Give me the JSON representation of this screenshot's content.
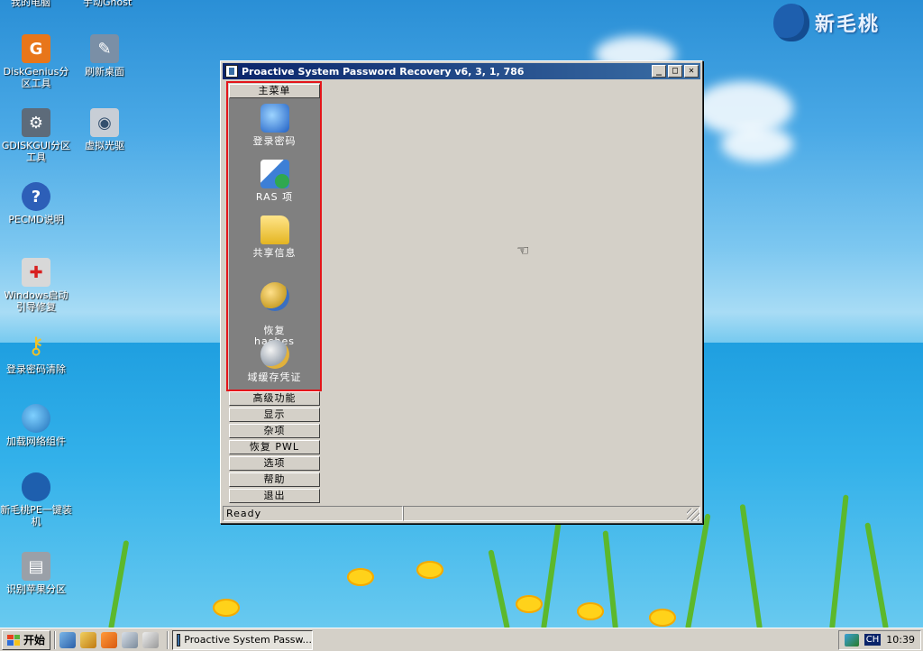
{
  "desktop": {
    "top_cut_labels": [
      "我的电脑",
      "手动Ghost"
    ],
    "logo_text": "新毛桃",
    "icons": [
      {
        "label": "DiskGenius分区工具",
        "icon": "diskgenius-icon",
        "color": "#e8761a",
        "glyph": "G"
      },
      {
        "label": "刷新桌面",
        "icon": "refresh-desktop-icon",
        "color": "#7a8fa6",
        "glyph": "✎"
      },
      {
        "label": "GDISKGUI分区工具",
        "icon": "gdiskgui-icon",
        "color": "#5d6b7a",
        "glyph": "⚙"
      },
      {
        "label": "虚拟光驱",
        "icon": "virtual-drive-icon",
        "color": "#c8ced6",
        "glyph": "◉"
      },
      {
        "label": "PECMD说明",
        "icon": "help-icon",
        "color": "#2d5fb8",
        "glyph": "?"
      },
      {
        "label": "Windows启动引导修复",
        "icon": "boot-repair-icon",
        "color": "#d8d8d8",
        "glyph": "✚"
      },
      {
        "label": "登录密码清除",
        "icon": "key-icon",
        "color": "#e8b21a",
        "glyph": "⚷"
      },
      {
        "label": "加载网络组件",
        "icon": "network-icon",
        "color": "#2f8fd6",
        "glyph": "◍"
      },
      {
        "label": "新毛桃PE一键装机",
        "icon": "install-icon",
        "color": "#1e5fae",
        "glyph": "●"
      },
      {
        "label": "识别苹果分区",
        "icon": "apple-partition-icon",
        "color": "#9aa0a8",
        "glyph": "▤"
      }
    ]
  },
  "window": {
    "title": "Proactive System Password Recovery v6, 3, 1, 786",
    "controls": {
      "minimize": "_",
      "maximize": "□",
      "close": "✕"
    },
    "main_menu_label": "主菜单",
    "panel_items": [
      {
        "label": "登录密码",
        "icon": "login-password-icon"
      },
      {
        "label": "RAS 项",
        "icon": "ras-icon"
      },
      {
        "label": "共享信息",
        "icon": "share-folder-icon"
      },
      {
        "label": "恢复\nhashes",
        "icon": "recover-hashes-icon"
      },
      {
        "label": "域缓存凭证",
        "icon": "domain-cache-icon"
      }
    ],
    "menu_buttons": [
      "高级功能",
      "显示",
      "杂项",
      "恢复 PWL",
      "选项",
      "帮助",
      "退出"
    ],
    "status_text": "Ready"
  },
  "taskbar": {
    "start_label": "开始",
    "task_button": "Proactive System Passw...",
    "ime": "CH",
    "clock": "10:39"
  }
}
